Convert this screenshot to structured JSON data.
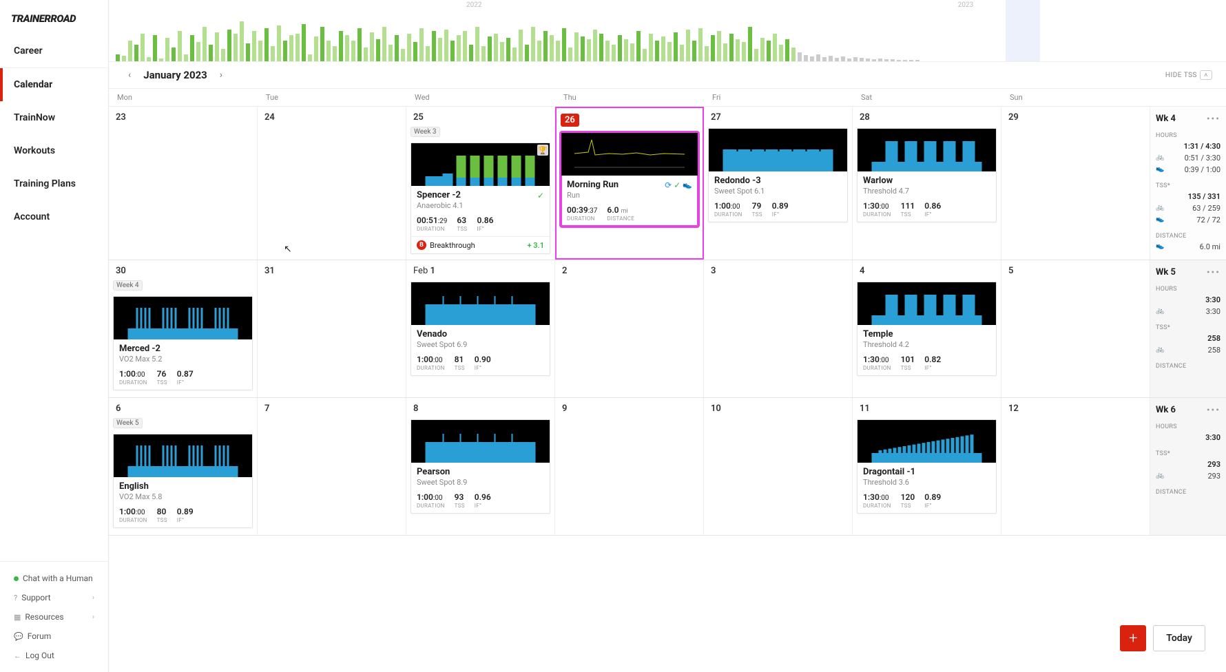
{
  "logo": "TRAINERROAD",
  "nav": [
    {
      "id": "career",
      "label": "Career"
    },
    {
      "id": "calendar",
      "label": "Calendar",
      "active": true
    },
    {
      "id": "trainnow",
      "label": "TrainNow"
    },
    {
      "id": "workouts",
      "label": "Workouts"
    },
    {
      "id": "trainingplans",
      "label": "Training Plans"
    },
    {
      "id": "account",
      "label": "Account"
    }
  ],
  "footer": [
    {
      "id": "chat",
      "label": "Chat with a Human",
      "dot": true
    },
    {
      "id": "support",
      "label": "Support",
      "icon": "?",
      "chev": true
    },
    {
      "id": "resources",
      "label": "Resources",
      "icon": "▦",
      "chev": true
    },
    {
      "id": "forum",
      "label": "Forum",
      "icon": "💬"
    },
    {
      "id": "logout",
      "label": "Log Out",
      "icon": "←"
    }
  ],
  "tss_years": {
    "y2022": "2022",
    "y2023": "2023"
  },
  "month": {
    "prev": "‹",
    "next": "›",
    "title": "January 2023"
  },
  "hide_tss_label": "HIDE TSS",
  "day_headers": [
    "Mon",
    "Tue",
    "Wed",
    "Thu",
    "Fri",
    "Sat",
    "Sun"
  ],
  "weeks": [
    {
      "summary": {
        "title": "Wk 4",
        "hours_lbl": "HOURS",
        "hours": "1:31 / 4:30",
        "bike": "0:51 / 3:30",
        "run": "0:39 / 1:00",
        "tss_lbl": "TSS*",
        "tss": "135 / 331",
        "bike_tss": "63 / 259",
        "run_tss": "72 / 72",
        "dist_lbl": "DISTANCE",
        "dist": "6.0 mi",
        "dist_icon": "run"
      },
      "current": true,
      "days": [
        {
          "num": "23"
        },
        {
          "num": "24"
        },
        {
          "num": "25",
          "week_badge": "Week 3",
          "workouts": [
            {
              "id": "spencer",
              "title": "Spencer -2",
              "sub": "Anaerobic 4.1",
              "type": "interval-green",
              "trophy": true,
              "check": true,
              "stats": {
                "duration": "00:51",
                "dur_sec": ":29",
                "tss": "63",
                "if": "0.86"
              },
              "breakthrough": {
                "label": "Breakthrough",
                "delta": "+ 3.1"
              }
            }
          ]
        },
        {
          "num": "26",
          "today": true,
          "workouts": [
            {
              "id": "morningrun",
              "title": "Morning Run",
              "sub": "Run",
              "type": "run-line",
              "sync": true,
              "check": true,
              "shoe": true,
              "stats": {
                "duration": "00:39",
                "dur_sec": ":37",
                "distance": "6.0",
                "dist_unit": "mi"
              }
            }
          ]
        },
        {
          "num": "27",
          "workouts": [
            {
              "id": "redondo",
              "title": "Redondo -3",
              "sub": "Sweet Spot 6.1",
              "type": "steady-blue",
              "stats": {
                "duration": "1:00",
                "dur_sec": ":00",
                "tss": "79",
                "if": "0.89"
              }
            }
          ]
        },
        {
          "num": "28",
          "workouts": [
            {
              "id": "warlow",
              "title": "Warlow",
              "sub": "Threshold 4.7",
              "type": "interval-blue",
              "stats": {
                "duration": "1:30",
                "dur_sec": ":00",
                "tss": "111",
                "if": "0.86"
              }
            }
          ]
        },
        {
          "num": "29"
        }
      ]
    },
    {
      "summary": {
        "title": "Wk 5",
        "hours_lbl": "HOURS",
        "hours": "3:30",
        "bike": "3:30",
        "tss_lbl": "TSS*",
        "tss": "258",
        "bike_tss": "258",
        "dist_lbl": "DISTANCE"
      },
      "days": [
        {
          "num": "30",
          "week_badge": "Week 4",
          "workouts": [
            {
              "id": "merced",
              "title": "Merced -2",
              "sub": "VO2 Max 5.2",
              "type": "vo2-blue",
              "stats": {
                "duration": "1:00",
                "dur_sec": ":00",
                "tss": "76",
                "if": "0.87"
              }
            }
          ]
        },
        {
          "num": "31"
        },
        {
          "num": "1",
          "month_label": "Feb",
          "workouts": [
            {
              "id": "venado",
              "title": "Venado",
              "sub": "Sweet Spot 6.9",
              "type": "steady-blue2",
              "stats": {
                "duration": "1:00",
                "dur_sec": ":00",
                "tss": "81",
                "if": "0.90"
              }
            }
          ]
        },
        {
          "num": "2"
        },
        {
          "num": "3"
        },
        {
          "num": "4",
          "workouts": [
            {
              "id": "temple",
              "title": "Temple",
              "sub": "Threshold 4.2",
              "type": "interval-blue2",
              "stats": {
                "duration": "1:30",
                "dur_sec": ":00",
                "tss": "101",
                "if": "0.82"
              }
            }
          ]
        },
        {
          "num": "5"
        }
      ]
    },
    {
      "summary": {
        "title": "Wk 6",
        "hours_lbl": "HOURS",
        "hours": "3:30",
        "tss_lbl": "TSS*",
        "tss": "293",
        "bike_tss": "293",
        "dist_lbl": "DISTANCE"
      },
      "days": [
        {
          "num": "6",
          "week_badge": "Week 5",
          "workouts": [
            {
              "id": "english",
              "title": "English",
              "sub": "VO2 Max 5.8",
              "type": "vo2-blue2",
              "stats": {
                "duration": "1:00",
                "dur_sec": ":00",
                "tss": "80",
                "if": "0.89"
              }
            }
          ]
        },
        {
          "num": "7"
        },
        {
          "num": "8",
          "workouts": [
            {
              "id": "pearson",
              "title": "Pearson",
              "sub": "Sweet Spot 8.9",
              "type": "steady-blue3",
              "stats": {
                "duration": "1:00",
                "dur_sec": ":00",
                "tss": "93",
                "if": "0.96"
              }
            }
          ]
        },
        {
          "num": "9"
        },
        {
          "num": "10"
        },
        {
          "num": "11",
          "workouts": [
            {
              "id": "dragontail",
              "title": "Dragontail -1",
              "sub": "Threshold 3.6",
              "type": "ramp-blue",
              "stats": {
                "duration": "1:30",
                "dur_sec": ":00",
                "tss": "120",
                "if": "0.89"
              }
            }
          ]
        },
        {
          "num": "12"
        }
      ]
    }
  ],
  "stat_labels": {
    "duration": "DURATION",
    "tss": "TSS",
    "if": "IF",
    "distance": "DISTANCE"
  },
  "add_btn": "+",
  "today_btn": "Today",
  "tss_bar_heights": [
    10,
    8,
    30,
    24,
    40,
    6,
    38,
    4,
    34,
    20,
    44,
    10,
    38,
    28,
    50,
    24,
    42,
    18,
    46,
    40,
    58,
    26,
    44,
    30,
    48,
    22,
    52,
    30,
    38,
    40,
    54,
    10,
    36,
    50,
    30,
    22,
    44,
    38,
    30,
    48,
    20,
    42,
    32,
    50,
    24,
    38,
    18,
    40,
    28,
    48,
    22,
    44,
    34,
    46,
    30,
    38,
    44,
    24,
    50,
    22,
    36,
    40,
    28,
    34,
    20,
    46,
    24,
    50,
    30,
    44,
    38,
    30,
    48,
    20,
    42,
    36,
    32,
    46,
    40,
    30,
    24,
    38,
    32,
    26,
    44,
    18,
    40,
    30,
    36,
    28,
    42,
    24,
    46,
    30,
    48,
    22,
    38,
    44,
    26,
    40,
    32,
    28,
    50,
    18,
    34,
    30,
    40,
    24,
    32,
    20,
    13,
    9,
    7,
    10,
    6,
    8,
    5,
    7,
    4,
    6,
    5,
    4,
    3,
    4,
    3,
    3,
    2,
    2,
    2,
    2
  ]
}
